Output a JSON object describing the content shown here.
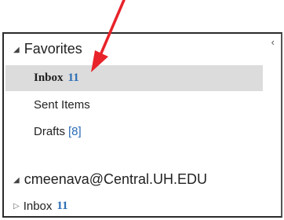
{
  "collapse_glyph": "‹",
  "favorites": {
    "header": "Favorites",
    "items": [
      {
        "label": "Inbox",
        "count": "11"
      },
      {
        "label": "Sent Items",
        "count": ""
      },
      {
        "label": "Drafts",
        "count": "[8]"
      }
    ]
  },
  "account": {
    "email": "cmeenava@Central.UH.EDU",
    "items": [
      {
        "label": "Inbox",
        "count": "11"
      }
    ]
  },
  "colors": {
    "count": "#2a6db5",
    "selected_bg": "#dcdcdc",
    "annotation_arrow": "#e8232a"
  },
  "icons": {
    "expanded": "triangle-down-icon",
    "collapsed": "triangle-right-icon",
    "collapse_pane": "chevron-left-icon",
    "annotation": "red-arrow-icon"
  }
}
